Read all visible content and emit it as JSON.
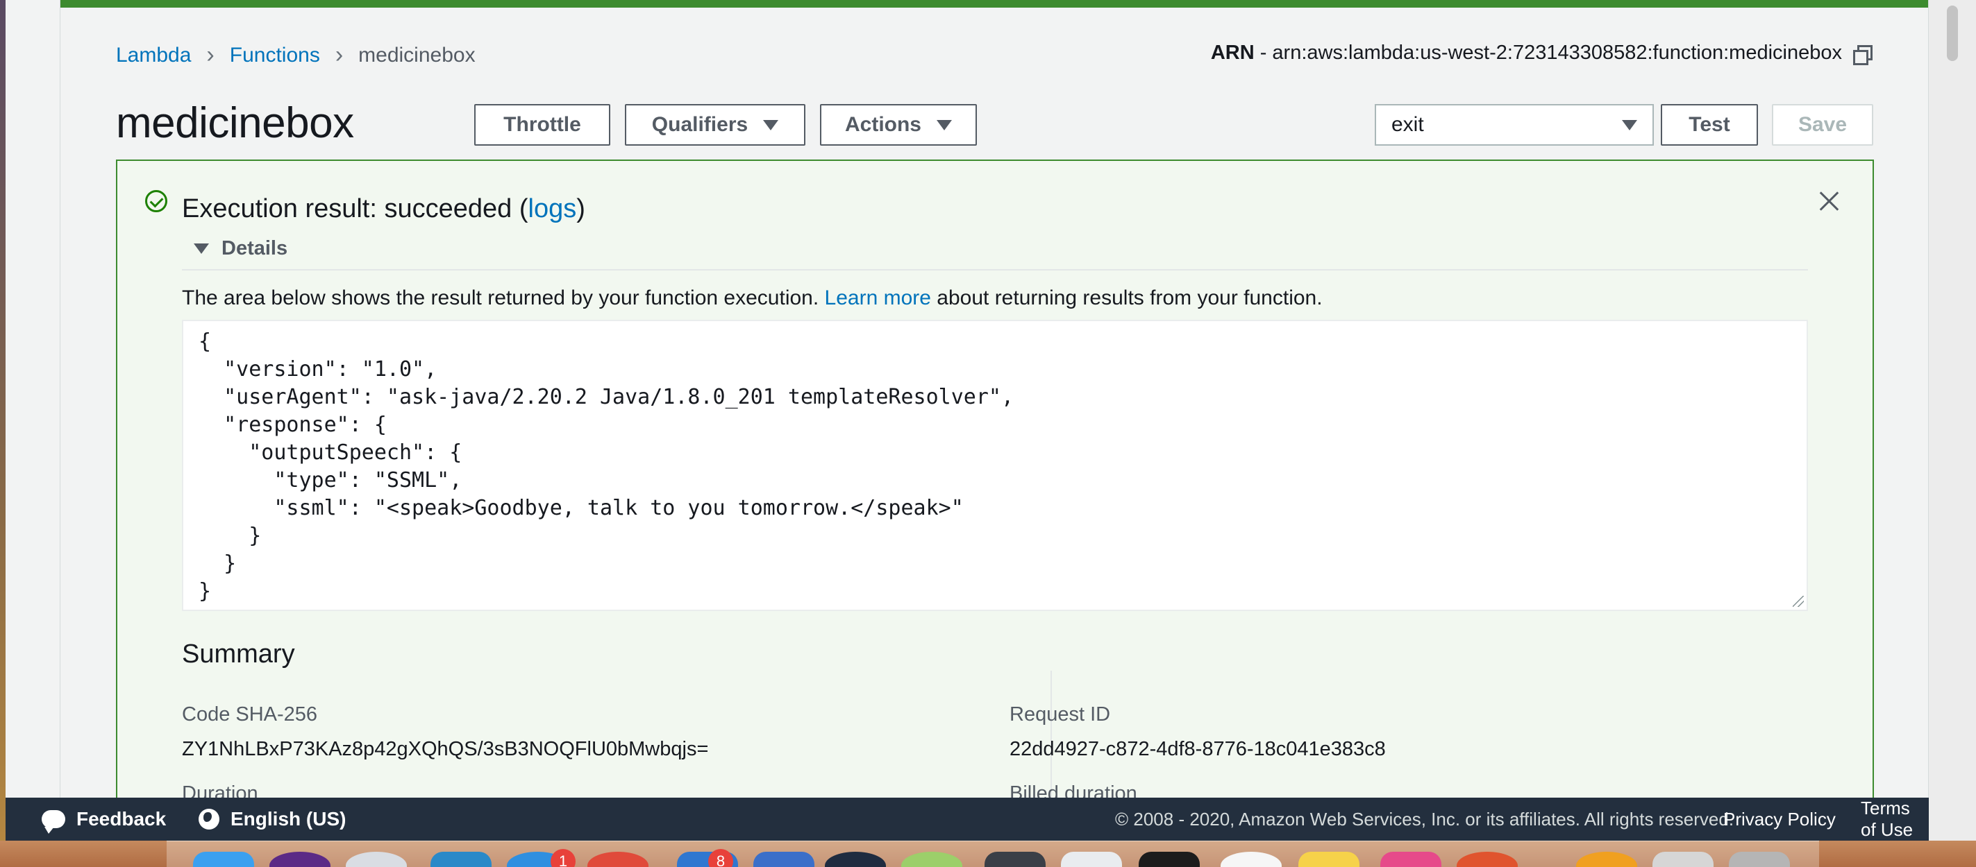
{
  "breadcrumb": {
    "items": [
      "Lambda",
      "Functions"
    ],
    "current": "medicinebox"
  },
  "arn": {
    "label": "ARN",
    "value": "- arn:aws:lambda:us-west-2:723143308582:function:medicinebox"
  },
  "function": {
    "title": "medicinebox"
  },
  "toolbar": {
    "throttle_label": "Throttle",
    "qualifiers_label": "Qualifiers",
    "actions_label": "Actions",
    "test_event_selected": "exit",
    "test_label": "Test",
    "save_label": "Save"
  },
  "execution": {
    "title_prefix": "Execution result: succeeded (",
    "logs_link": "logs",
    "title_suffix": ")",
    "details_label": "Details",
    "desc_before": "The area below shows the result returned by your function execution. ",
    "learn_more": "Learn more",
    "desc_after": " about returning results from your function.",
    "output": "{\n  \"version\": \"1.0\",\n  \"userAgent\": \"ask-java/2.20.2 Java/1.8.0_201 templateResolver\",\n  \"response\": {\n    \"outputSpeech\": {\n      \"type\": \"SSML\",\n      \"ssml\": \"<speak>Goodbye, talk to you tomorrow.</speak>\"\n    }\n  }\n}"
  },
  "summary": {
    "heading": "Summary",
    "code_sha_label": "Code SHA-256",
    "code_sha_value": "ZY1NhLBxP73KAz8p42gXQhQS/3sB3NOQFlU0bMwbqjs=",
    "request_id_label": "Request ID",
    "request_id_value": "22dd4927-c872-4df8-8776-18c041e383c8",
    "duration_label": "Duration",
    "billed_duration_label": "Billed duration"
  },
  "footer": {
    "feedback": "Feedback",
    "language": "English (US)",
    "copyright": "© 2008 - 2020, Amazon Web Services, Inc. or its affiliates. All rights reserved.",
    "privacy": "Privacy Policy",
    "terms": "Terms of Use"
  },
  "dock": {
    "badges": [
      "1",
      "8"
    ]
  },
  "colors": {
    "success_green": "#3d8b2f",
    "link_blue": "#0073bb",
    "footer_bg": "#232f3e"
  }
}
